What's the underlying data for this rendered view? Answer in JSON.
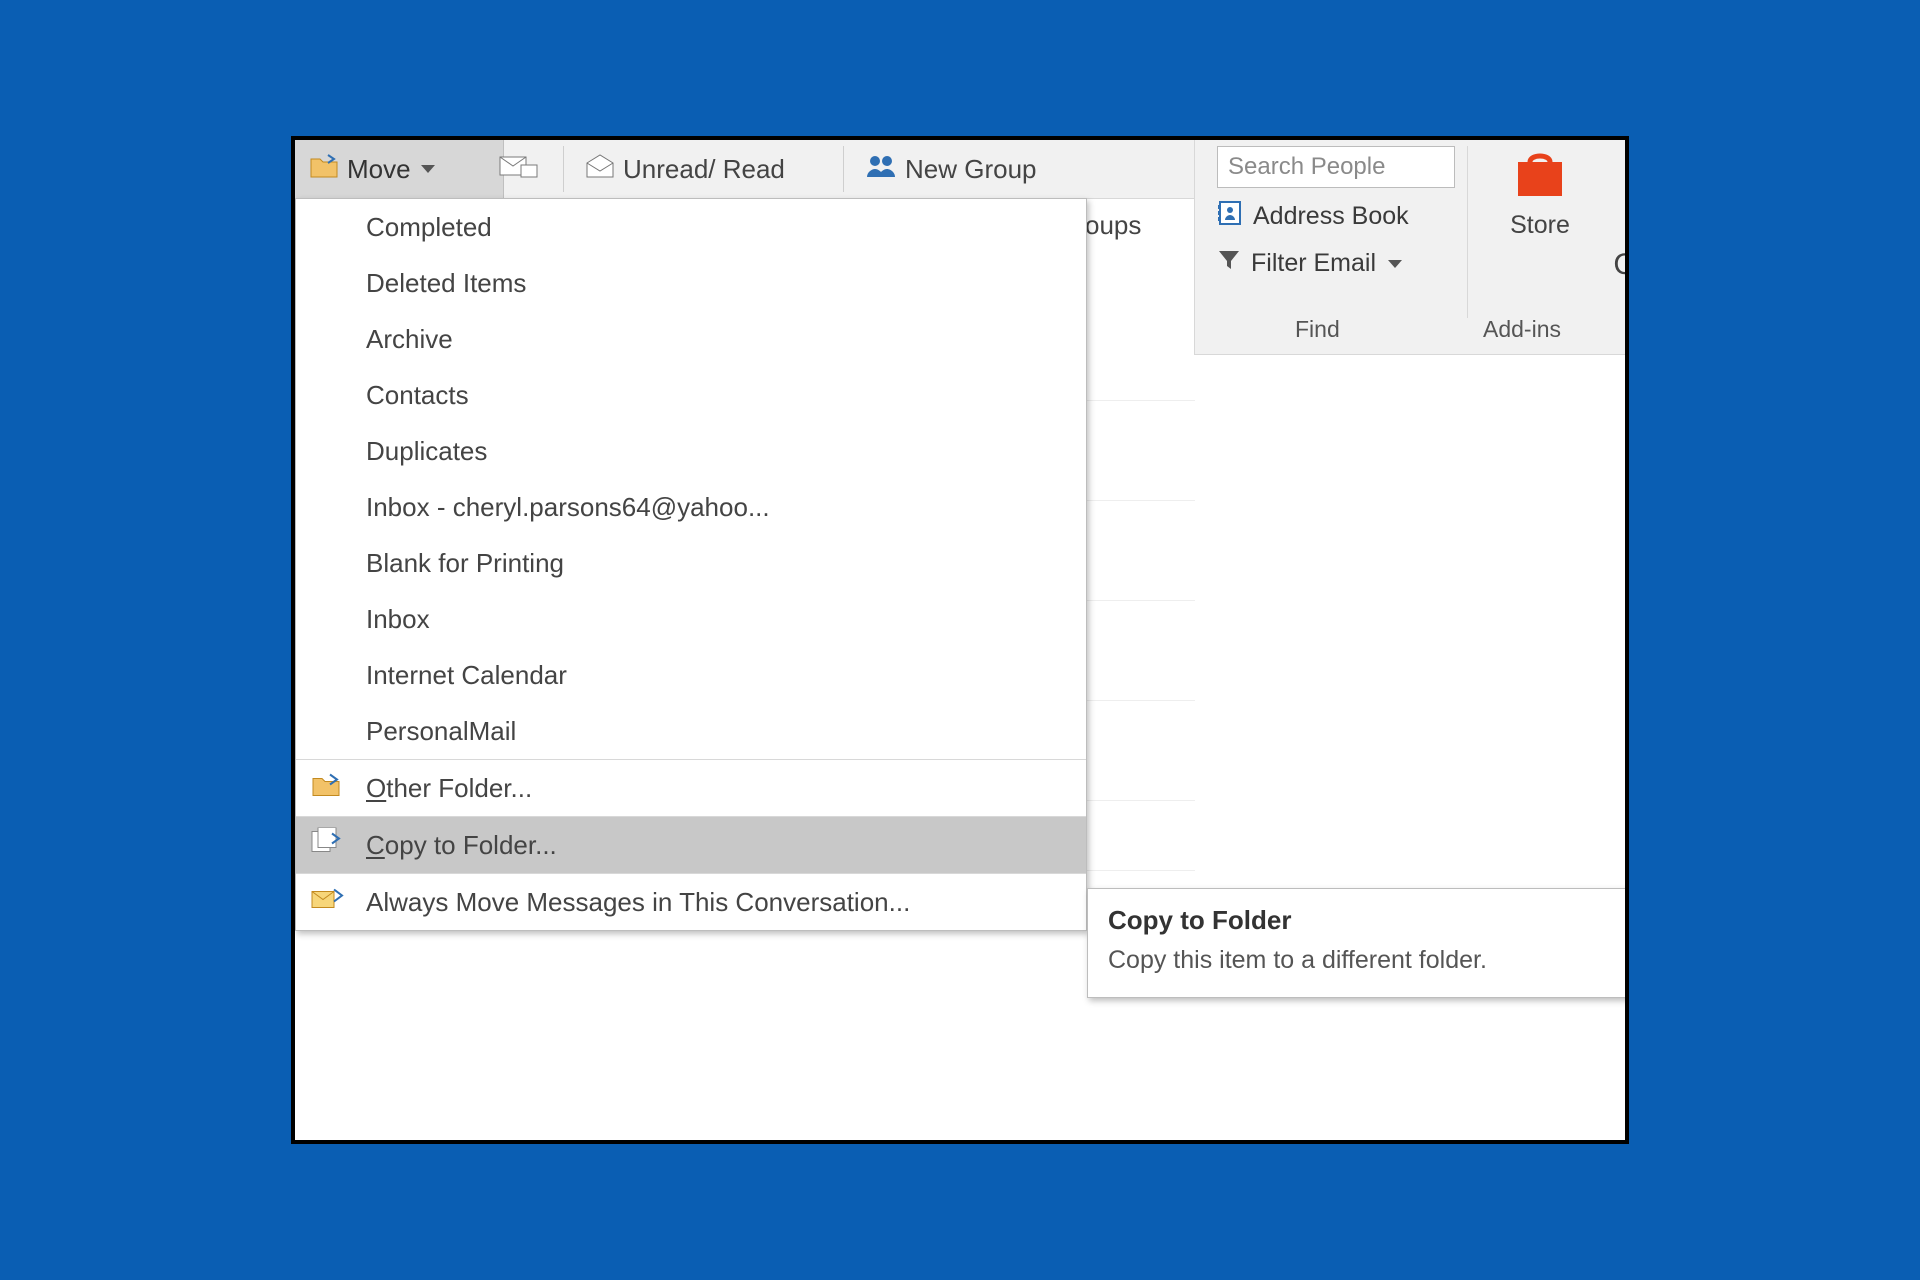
{
  "ribbon": {
    "move_label": "Move",
    "unread_read_label": "Unread/ Read",
    "new_group_label": "New Group",
    "groups_partial": "oups",
    "find_group_label": "Find",
    "addins_group_label": "Add-ins",
    "search_placeholder": "Search People",
    "address_book_label": "Address Book",
    "filter_email_label": "Filter Email",
    "store_label": "Store",
    "cropped_right": "C"
  },
  "menu": {
    "folders": [
      "Completed",
      "Deleted Items",
      "Archive",
      "Contacts",
      "Duplicates",
      "Inbox - cheryl.parsons64@yahoo...",
      "Blank for Printing",
      "Inbox",
      "Internet Calendar",
      "PersonalMail"
    ],
    "other_folder": {
      "u": "O",
      "rest": "ther Folder..."
    },
    "copy_to_folder": {
      "u": "C",
      "rest": "opy to Folder..."
    },
    "always_move": {
      "pre": "Always Move Messages in This Conversation..."
    }
  },
  "tooltip": {
    "title": "Copy to Folder",
    "body": "Copy this item to a different folder."
  }
}
